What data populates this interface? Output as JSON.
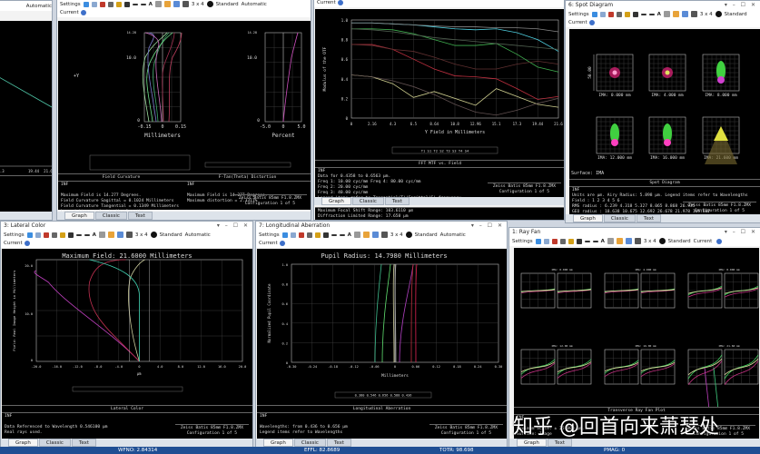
{
  "toolbar": {
    "settings": "Settings",
    "layout": "3 x 4",
    "standard": "Standard",
    "automatic": "Automatic",
    "current": "Current"
  },
  "tabs": {
    "graph": "Graph",
    "classic": "Classic",
    "text": "Text"
  },
  "config": {
    "lens": "Zeiss Batis 85mm F1.8.ZMX",
    "configuration": "Configuration 1 of 5"
  },
  "left_partial": {
    "automatic": "Automatic",
    "ticks": [
      "7.3",
      "19.44",
      "21.6"
    ]
  },
  "field_curvature": {
    "y_ticks": [
      "14.28",
      "10.0",
      "0"
    ],
    "y_label": "+Y",
    "fc_x_ticks": [
      "-0.15",
      "0",
      "0.15"
    ],
    "fc_x_label": "Millimeters",
    "d_x_ticks": [
      "-5.0",
      "0",
      "5.0"
    ],
    "d_x_label": "Percent",
    "left_title": "Field Curvature",
    "right_title": "F-Tan(Theta) Distortion",
    "left_info": [
      "INF",
      "",
      "Maximum Field is 14.277 Degrees.",
      "Field Curvature Sagittal = 0.1024 Millimeters",
      "Field Curvature Tangential = 0.1349 Millimeters",
      "Legend items refer to Wavelengths"
    ],
    "right_info": [
      "INF",
      "",
      "Maximum Field is 14.277 Degrees.",
      "Maximum distortion = 2.3317%"
    ]
  },
  "mtf": {
    "y_label": "Modulus of the OTF",
    "y_ticks": [
      "1.0",
      "0.8",
      "0.6",
      "0.4",
      "0.2",
      "0"
    ],
    "x_ticks": [
      "0",
      "2.16",
      "4.3",
      "6.5",
      "8.64",
      "10.8",
      "12.96",
      "15.1",
      "17.3",
      "19.44",
      "21.6"
    ],
    "x_label": "Y Field in Millimeters",
    "legend": "T1 S1 T2 S2 T3 S3 T4 S4",
    "title": "FFT MTF vs. Field",
    "info": [
      "INF",
      "Data for 0.4358 to 0.6563 µm.",
      "Freq 1:   10.00 cyc/mm      Freq 4:   80.00 cyc/mm",
      "Freq 2:   20.00 cyc/mm",
      "Freq 3:   40.00 cyc/mm",
      "Legend items refer to Tangential(T)/Sagittal(S) frequency"
    ],
    "behind_info": [
      "Maximum Focal Shift Range: 103.6110 µm",
      "Diffraction Limited Range: 17.658 µm"
    ]
  },
  "spot": {
    "window_title": "6: Spot Diagram",
    "scale": "50.00",
    "labels": [
      "IMA: 0.000 mm",
      "IMA: 4.000 mm",
      "IMA: 8.000 mm",
      "IMA: 12.000 mm",
      "IMA: 16.000 mm",
      "IMA: 21.600 mm"
    ],
    "surface": "Surface: IMA",
    "title": "Spot Diagram",
    "info": [
      "INF",
      "Units are µm.       Airy Radius: 5.898 µm. Legend items refer to Wavelengths",
      "Field      :     1        2        3        4        5        6",
      "RMS radius :   6.239    4.318    5.327    8.065    8.868   26.935",
      "GEO radius :  18.638   10.675   12.692   26.678   21.978  165.887",
      "Scale bar  : 50     Reference  : Chief Ray"
    ]
  },
  "lateral": {
    "window_title": "3: Lateral Color",
    "heading": "Maximum Field: 21.6000 Millimeters",
    "y_label": "Field: Real Image Height in Millimeters",
    "y_ticks": [
      "20.0",
      "10.0",
      "0"
    ],
    "x_ticks": [
      "-20.0",
      "-16.0",
      "-12.0",
      "-8.0",
      "-4.0",
      "0",
      "4.0",
      "8.0",
      "12.0",
      "16.0",
      "20.0"
    ],
    "x_label": "µm",
    "title": "Lateral Color",
    "info": [
      "INF",
      "",
      "Data Referenced to Wavelength 0.546100 µm",
      "Real rays used."
    ]
  },
  "longitudinal": {
    "window_title": "7: Longitudinal Aberration",
    "heading": "Pupil Radius: 14.7980 Millimeters",
    "y_label": "Normalized Pupil Coordinate",
    "y_ticks": [
      "1.0",
      "0.8",
      "0.6",
      "0.4",
      "0.2",
      "0"
    ],
    "x_ticks": [
      "-0.30",
      "-0.24",
      "-0.18",
      "-0.12",
      "-0.06",
      "0",
      "0.06",
      "0.12",
      "0.18",
      "0.24",
      "0.30"
    ],
    "x_label": "Millimeters",
    "legend": "0.380  0.546  0.656  0.588  0.436",
    "title": "Longitudinal Aberration",
    "info": [
      "INF",
      "",
      "Wavelengths: from 0.436 to 0.656 µm",
      "Legend items refer to Wavelengths"
    ]
  },
  "rayfan": {
    "window_title": "1: Ray Fan",
    "field_labels": [
      "IMA: 0.000 mm",
      "IMA: 4.000 mm",
      "IMA: 8.000 mm",
      "IMA: 12.00 mm",
      "IMA: 16.00 mm",
      "IMA: 21.60 mm"
    ],
    "title": "Transverse Ray Fan Plot",
    "info": [
      "INF",
      "",
      "Maximum Scale: ± 25.000 µm.",
      "Surface: Image"
    ]
  },
  "status": {
    "wfno": "WFNO: 2.84314",
    "effl": "EFFL: 82.8689",
    "totr": "TOTR: 98.698",
    "pmag": "PMAG: 0"
  },
  "watermark": "知乎 @回首向来萧瑟处",
  "colors": {
    "plot_bg": "#000000",
    "status_bar": "#1f4e93",
    "grid": "#555555"
  }
}
